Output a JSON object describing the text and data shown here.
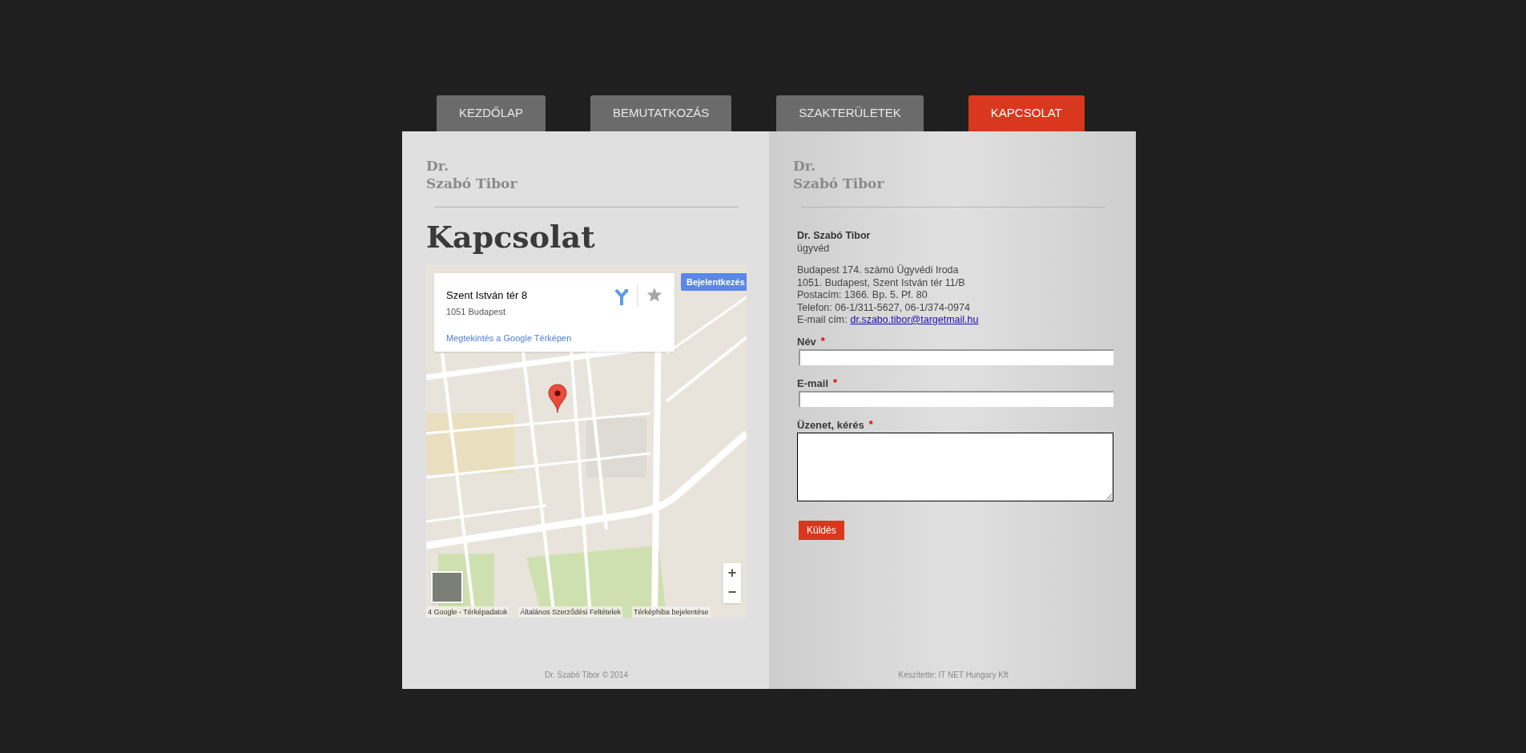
{
  "nav_tabs": [
    {
      "label": "KEZDŐLAP",
      "selected": false
    },
    {
      "label": "BEMUTATKOZÁS",
      "selected": false
    },
    {
      "label": "SZAKTERÜLETEK",
      "selected": false
    },
    {
      "label": "KAPCSOLAT",
      "selected": true
    }
  ],
  "left_page": {
    "site_name": [
      "Dr.",
      "Szabó Tibor"
    ],
    "heading": "Kapcsolat",
    "map": {
      "info_title": "Szent István tér 8",
      "info_address": "1051 Budapest",
      "info_link": "Megtekintés a Google Térképen",
      "sign_in_button": "Bejelentkezés",
      "zoom_in": "+",
      "zoom_out": "−",
      "attribution": [
        "4 Google - Térképadatok",
        "Általános Szerződési Feltételek",
        "Térképhiba bejelentése"
      ]
    },
    "footer": "Dr. Szabó Tibor © 2014"
  },
  "right_page": {
    "site_name": [
      "Dr.",
      "Szabó Tibor"
    ],
    "contact": {
      "name": "Dr. Szabó Tibor",
      "role": "ügyvéd",
      "lines": [
        "Budapest 174. számú Ügyvédi Iroda",
        "1051. Budapest, Szent István tér 11/B",
        "Postacím: 1366. Bp. 5. Pf. 80",
        "Telefon: 06-1/311-5627, 06-1/374-0974"
      ],
      "email_label": "E-mail cím:",
      "email": "dr.szabo.tibor@targetmail.hu"
    },
    "form": {
      "fields": [
        {
          "label": "Név",
          "required_mark": "*",
          "kind": "input"
        },
        {
          "label": "E-mail",
          "required_mark": "*",
          "kind": "input"
        },
        {
          "label": "Üzenet, kérés",
          "required_mark": "*",
          "kind": "textarea"
        }
      ],
      "submit": "Küldés"
    },
    "footer": "Készítette: IT NET Hungary Kft"
  }
}
